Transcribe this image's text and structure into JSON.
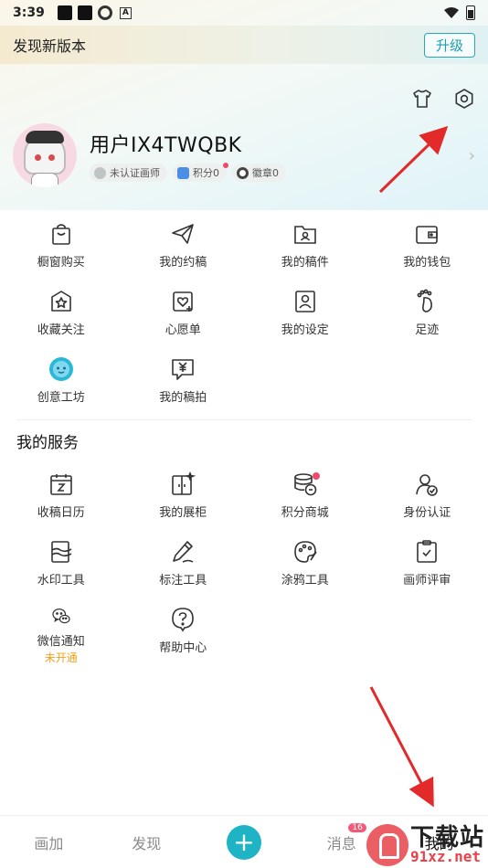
{
  "status_bar": {
    "time": "3:39"
  },
  "update_banner": {
    "text": "发现新版本",
    "button": "升级"
  },
  "profile": {
    "username": "用户IX4TWQBK",
    "badges": [
      {
        "label": "未认证画师",
        "icon": "badge-icon"
      },
      {
        "label": "积分0",
        "icon": "coin-stack-icon",
        "dot": true
      },
      {
        "label": "徽章0",
        "icon": "medal-icon"
      }
    ]
  },
  "main_menu": [
    {
      "label": "橱窗购买",
      "icon": "shopping-bag-icon"
    },
    {
      "label": "我的约稿",
      "icon": "paper-plane-icon"
    },
    {
      "label": "我的稿件",
      "icon": "folder-user-icon"
    },
    {
      "label": "我的钱包",
      "icon": "wallet-icon"
    },
    {
      "label": "收藏关注",
      "icon": "star-bag-icon"
    },
    {
      "label": "心愿单",
      "icon": "heart-list-icon"
    },
    {
      "label": "我的设定",
      "icon": "profile-card-icon"
    },
    {
      "label": "足迹",
      "icon": "footprint-icon"
    },
    {
      "label": "创意工坊",
      "icon": "workshop-icon"
    },
    {
      "label": "我的稿拍",
      "icon": "auction-icon"
    }
  ],
  "services": {
    "title": "我的服务",
    "items": [
      {
        "label": "收稿日历",
        "icon": "calendar-icon"
      },
      {
        "label": "我的展柜",
        "icon": "showcase-icon"
      },
      {
        "label": "积分商城",
        "icon": "points-mall-icon",
        "dot": true
      },
      {
        "label": "身份认证",
        "icon": "user-verify-icon"
      },
      {
        "label": "水印工具",
        "icon": "watermark-icon"
      },
      {
        "label": "标注工具",
        "icon": "pen-icon"
      },
      {
        "label": "涂鸦工具",
        "icon": "palette-icon"
      },
      {
        "label": "画师评审",
        "icon": "clipboard-check-icon"
      },
      {
        "label": "微信通知",
        "icon": "wechat-icon",
        "sub": "未开通"
      },
      {
        "label": "帮助中心",
        "icon": "help-icon"
      }
    ]
  },
  "bottom_nav": {
    "items": [
      "画加",
      "发现",
      "+",
      "消息",
      "我的"
    ],
    "message_count": "16"
  },
  "watermark": {
    "top": "下载站",
    "bottom": "91xz.net"
  },
  "colors": {
    "accent": "#1fb3c6",
    "badge_dot": "#f04a6a",
    "sub_orange": "#f2a21a"
  }
}
